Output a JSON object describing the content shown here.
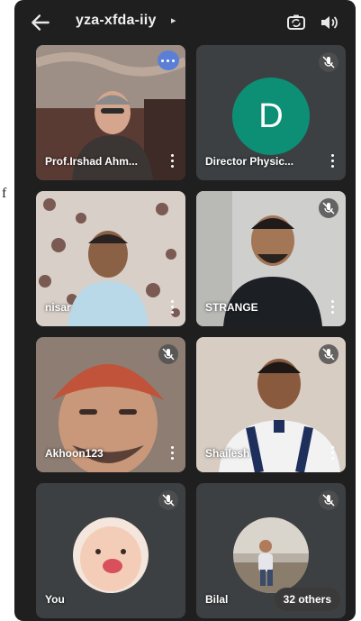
{
  "side_mark": "f",
  "header": {
    "meeting_code": "yza-xfda-iiy",
    "caret": "▸"
  },
  "participants": [
    {
      "name": "Prof.Irshad Ahm...",
      "mic_muted": false,
      "has_more_badge": true
    },
    {
      "name": "Director Physic...",
      "mic_muted": true,
      "avatar_letter": "D",
      "avatar_color": "#0d8f76"
    },
    {
      "name": "nisar",
      "mic_muted": false
    },
    {
      "name": "STRANGE",
      "mic_muted": true
    },
    {
      "name": "Akhoon123",
      "mic_muted": true
    },
    {
      "name": "Shailesh",
      "mic_muted": true
    },
    {
      "name": "You",
      "mic_muted": true
    },
    {
      "name": "Bilal",
      "mic_muted": true
    }
  ],
  "others_count_label": "32 others",
  "icons": [
    "back-arrow-icon",
    "switch-camera-icon",
    "speaker-icon",
    "mic-off-icon",
    "more-options-icon",
    "more-dots-icon"
  ],
  "colors": {
    "background": "#1f1f1f",
    "tile": "#3c4043",
    "avatar_green": "#0d8f76",
    "badge_blue": "#5b7fd6"
  }
}
